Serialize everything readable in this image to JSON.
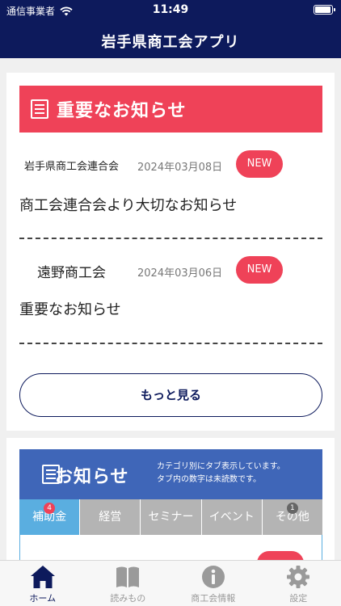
{
  "status_bar": {
    "carrier": "通信事業者",
    "time": "11:49",
    "battery_level": 1.0
  },
  "app": {
    "title": "岩手県商工会アプリ"
  },
  "important": {
    "header": "重要なお知らせ",
    "items": [
      {
        "org": "岩手県商工会連合会",
        "date": "2024年03月08日",
        "badge": "NEW",
        "title": "商工会連合会より大切なお知らせ"
      },
      {
        "org": "遠野商工会",
        "date": "2024年03月06日",
        "badge": "NEW",
        "title": "重要なお知らせ"
      }
    ],
    "more_label": "もっと見る"
  },
  "notices": {
    "header": "お知らせ",
    "sub_line1": "カテゴリ別にタブ表示しています。",
    "sub_line2": "タブ内の数字は未読数です。",
    "tabs": [
      {
        "label": "補助金",
        "count": "4",
        "active": true
      },
      {
        "label": "経営"
      },
      {
        "label": "セミナー"
      },
      {
        "label": "イベント"
      },
      {
        "label": "その他",
        "count": "1"
      }
    ]
  },
  "tabbar": [
    {
      "label": "ホーム",
      "icon": "home-icon",
      "active": true
    },
    {
      "label": "読みもの",
      "icon": "book-icon"
    },
    {
      "label": "商工会情報",
      "icon": "info-icon"
    },
    {
      "label": "設定",
      "icon": "gear-icon"
    }
  ],
  "colors": {
    "navy": "#0d1a5c",
    "red": "#ef4258",
    "blue": "#3f66b8",
    "tab_active": "#5aaee0",
    "tab_inactive": "#b4b4b4"
  }
}
